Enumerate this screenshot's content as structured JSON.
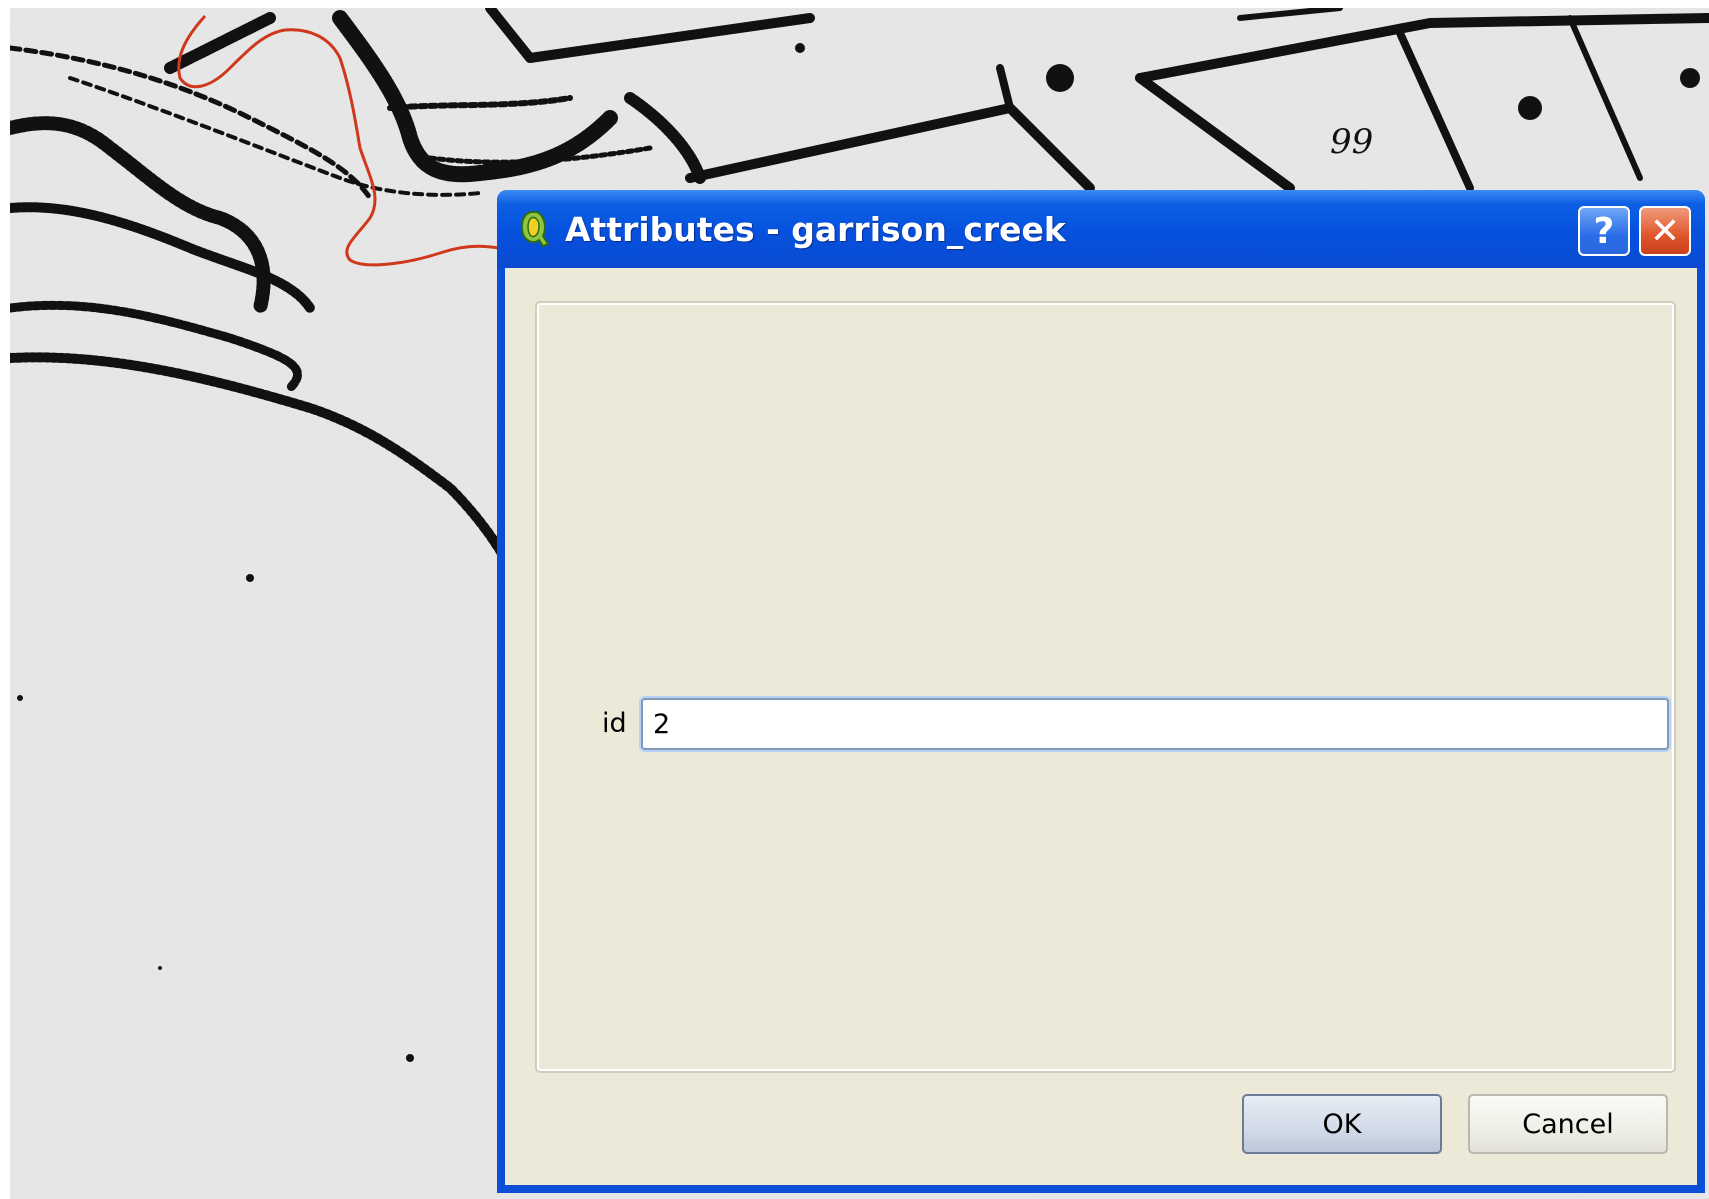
{
  "map": {
    "label_text": "99",
    "feature_color": "#d0381c"
  },
  "dialog": {
    "title": "Attributes - garrison_creek",
    "title_icon": "qgis-logo-icon",
    "help_label": "?",
    "close_label": "✕",
    "fields": [
      {
        "label": "id",
        "value": "2"
      }
    ],
    "ok_label": "OK",
    "cancel_label": "Cancel"
  },
  "colors": {
    "titlebar_blue": "#0551de",
    "dialog_bg": "#ece9d8",
    "close_red": "#e0562a"
  }
}
